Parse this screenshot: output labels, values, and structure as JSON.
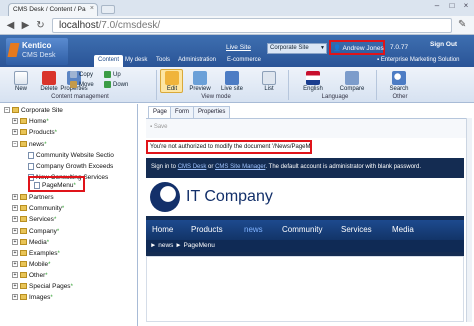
{
  "browser": {
    "tab_title": "CMS Desk / Content / Pa",
    "url_host": "localhost",
    "url_path": "/7.0/cmsdesk/"
  },
  "header": {
    "logo_name": "Kentico",
    "logo_sub": "CMS Desk",
    "tabs": [
      "Content",
      "My desk",
      "Tools",
      "Administration",
      "E-commerce"
    ],
    "live_site": "Live Site",
    "site_select": "Corporate Site",
    "user": "Andrew Jones",
    "version": "7.0.77",
    "sign_out": "Sign Out",
    "product": "Enterprise Marketing Solution"
  },
  "ribbon": {
    "content_mgmt": {
      "new": "New",
      "delete": "Delete",
      "properties": "Properties",
      "copy": "Copy",
      "move": "Move",
      "up": "Up",
      "down": "Down",
      "group": "Content management"
    },
    "view_mode": {
      "edit": "Edit",
      "preview": "Preview",
      "live_site": "Live site",
      "list": "List",
      "group": "View mode"
    },
    "language": {
      "selected": "English",
      "compare": "Compare",
      "group": "Language"
    },
    "other": {
      "search": "Search",
      "group": "Other"
    }
  },
  "tree": {
    "root": "Corporate Site",
    "nodes": [
      "Home",
      "Products",
      "news",
      "Community Website Sectio",
      "Company Growth Exceeds",
      "New Consulting Services",
      "PageMenu",
      "Partners",
      "Community",
      "Services",
      "Company",
      "Media",
      "Examples",
      "Mobile",
      "Other",
      "Special Pages",
      "Images"
    ]
  },
  "page_tabs": [
    "Page",
    "Form",
    "Properties"
  ],
  "save_label": "Save",
  "error_message": "You're not authorized to modify the document '/News/PageMenu'.",
  "site": {
    "info_prefix": "Sign in to",
    "cms_desk_link": "CMS Desk",
    "or_text": "or",
    "site_manager_link": "CMS Site Manager",
    "info_suffix": ". The default account is administrator with blank password.",
    "logo_text": "IT Company",
    "nav": [
      "Home",
      "Products",
      "news",
      "Community",
      "Services",
      "Media"
    ],
    "breadcrumb": "► news ► PageMenu"
  },
  "colors": {
    "highlight": "#e0141a",
    "header_blue": "#2a5497",
    "site_navy": "#142c52"
  }
}
